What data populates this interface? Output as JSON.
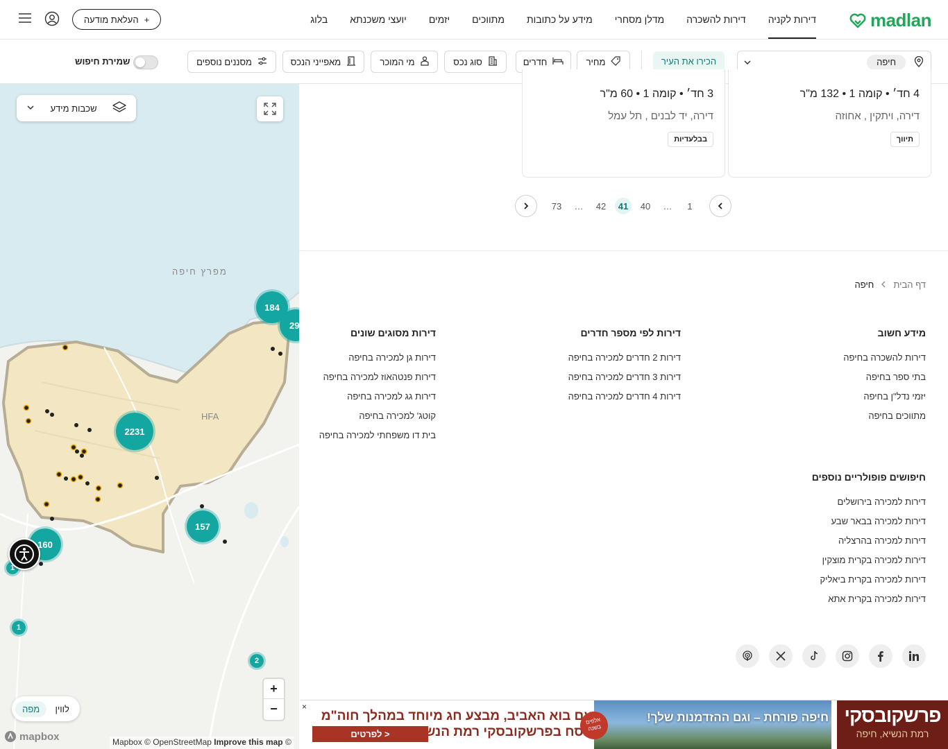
{
  "header": {
    "logo_text": "madlan",
    "nav": [
      "דירות לקניה",
      "דירות להשכרה",
      "מדלן מסחרי",
      "מידע על כתובות",
      "מתווכים",
      "יזמים",
      "יועצי משכנתא",
      "בלוג"
    ],
    "upload_label": "העלאת מודעה",
    "upload_plus": "+"
  },
  "filters": {
    "city": "חיפה",
    "know_city": "הכירו את העיר",
    "price": "מחיר",
    "rooms": "חדרים",
    "property_type": "סוג נכס",
    "seller": "מי המוכר",
    "features": "מאפייני הנכס",
    "more": "מסננים נוספים",
    "save_search": "שמירת חיפוש"
  },
  "map": {
    "layers_label": "שכבות מידע",
    "bay_label": "מפרץ חיפה",
    "hfa_label": "HFA",
    "clusters": [
      "184",
      "29",
      "2231",
      "157",
      "160",
      "1",
      "1",
      "2"
    ],
    "zoom_in": "+",
    "zoom_out": "−",
    "view_map": "מפה",
    "view_list": "לווין",
    "attribution": "Mapbox © OpenStreetMap",
    "improve": "Improve this map",
    "copyright": "©",
    "mapbox_logo": "mapbox"
  },
  "listings": [
    {
      "title": "4 חד׳ • קומה 1 • 132 מ\"ר",
      "subtitle": "דירה, ויתקין , אחוזה",
      "tag": "תיווך"
    },
    {
      "title": "3 חד׳ • קומה 1 • 60 מ\"ר",
      "subtitle": "דירה, יד לבנים , תל עמל",
      "tag": "בבלעדיות"
    }
  ],
  "pagination": {
    "pages": [
      "1",
      "…",
      "40",
      "41",
      "42",
      "…",
      "73"
    ],
    "current": "41"
  },
  "breadcrumb": {
    "home": "דף הבית",
    "current": "חיפה"
  },
  "footer": {
    "col1": {
      "title": "מידע חשוב",
      "links": [
        "דירות להשכרה בחיפה",
        "בתי ספר בחיפה",
        "יזמי נדל\"ן בחיפה",
        "מתווכים בחיפה"
      ]
    },
    "col2": {
      "title": "דירות לפי מספר חדרים",
      "links": [
        "דירות 2 חדרים למכירה בחיפה",
        "דירות 3 חדרים למכירה בחיפה",
        "דירות 4 חדרים למכירה בחיפה"
      ]
    },
    "col3": {
      "title": "דירות מסוגים שונים",
      "links": [
        "דירות גן למכירה בחיפה",
        "דירות פנטהאוז למכירה בחיפה",
        "דירות גג למכירה בחיפה",
        "קוטג' למכירה בחיפה",
        "בית דו משפחתי למכירה בחיפה"
      ]
    },
    "popular": {
      "title": "חיפושים פופולריים נוספים",
      "links": [
        "דירות למכירה בירושלים",
        "דירות למכירה בבאר שבע",
        "דירות למכירה בהרצליה",
        "דירות למכירה בקרית מוצקין",
        "דירות למכירה בקרית ביאליק",
        "דירות למכירה בקרית אתא"
      ]
    }
  },
  "banner": {
    "close": "×",
    "headline": "עם בוא האביב, מבצע חג מיוחד במהלך חוה\"מ פסח בפרשקובסקי רמת הנשיא",
    "cta": "לפרטים >",
    "badge": "אלפים בשנה",
    "photo_text": "חיפה פורחת – וגם ההזדמנות שלך!",
    "brand": "פרשקובסקי",
    "brand_sub": "רמת הנשיא, חיפה"
  },
  "colors": {
    "accent": "#14a7a2",
    "brand_green": "#22a65a"
  }
}
